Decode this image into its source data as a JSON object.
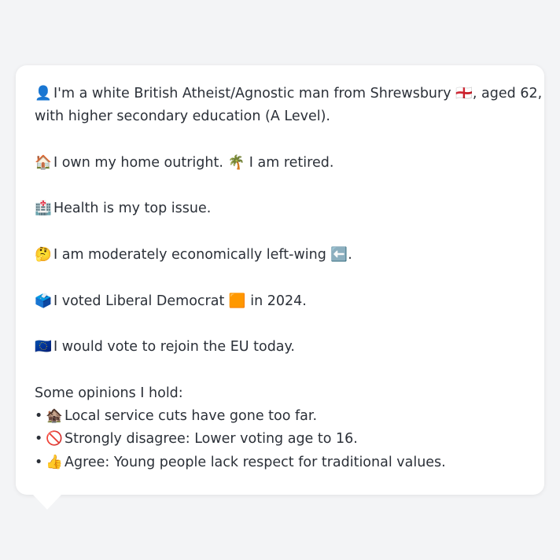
{
  "profile": {
    "identity": {
      "icon": "👤",
      "line1": "I'm a white British Atheist/Agnostic man from Shrewsbury 🏴󠁧󠁢󠁥󠁮󠁧󠁿, aged 62,",
      "line2": "with higher secondary education (A Level)."
    },
    "housing": {
      "icon": "🏠",
      "text": "I own my home outright. 🌴 I am retired."
    },
    "issue": {
      "icon": "🏥",
      "text": "Health is my top issue."
    },
    "economics": {
      "icon": "🤔",
      "text": "I am moderately economically left-wing ⬅️."
    },
    "vote": {
      "icon": "🗳️",
      "text": "I voted Liberal Democrat 🟧 in 2024."
    },
    "eu": {
      "icon": "🇪🇺",
      "text": "I would vote to rejoin the EU today."
    },
    "opinions": {
      "heading": "Some opinions I hold:",
      "bullet": "•",
      "items": [
        {
          "icon": "🏚️",
          "text": "Local service cuts have gone too far."
        },
        {
          "icon": "🚫",
          "text": "Strongly disagree: Lower voting age to 16."
        },
        {
          "icon": "👍",
          "text": "Agree: Young people lack respect for traditional values."
        }
      ]
    }
  },
  "colors": {
    "background": "#f3f4f6",
    "card": "#ffffff",
    "text": "#2b3038"
  }
}
